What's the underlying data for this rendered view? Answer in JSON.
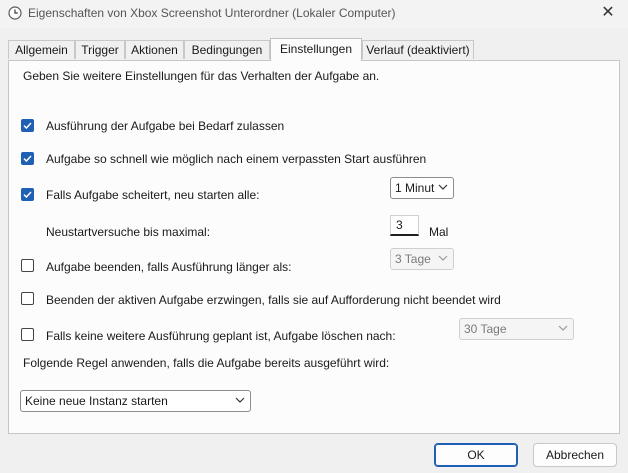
{
  "window": {
    "title": "Eigenschaften von Xbox Screenshot Unterordner (Lokaler Computer)",
    "title_icon": "clock-icon",
    "close_glyph": "✕"
  },
  "tabs": [
    {
      "label": "Allgemein",
      "active": false
    },
    {
      "label": "Trigger",
      "active": false
    },
    {
      "label": "Aktionen",
      "active": false
    },
    {
      "label": "Bedingungen",
      "active": false
    },
    {
      "label": "Einstellungen",
      "active": true
    },
    {
      "label": "Verlauf (deaktiviert)",
      "active": false
    }
  ],
  "settings": {
    "intro": "Geben Sie weitere Einstellungen für das Verhalten der Aufgabe an.",
    "allow_on_demand": {
      "label": "Ausführung der Aufgabe bei Bedarf zulassen",
      "checked": true
    },
    "run_asap": {
      "label": "Aufgabe so schnell wie möglich nach einem verpassten Start ausführen",
      "checked": true
    },
    "restart_on_fail": {
      "label": "Falls Aufgabe scheitert, neu starten alle:",
      "checked": true,
      "interval": "1 Minut"
    },
    "restart_attempts": {
      "label": "Neustartversuche bis maximal:",
      "value": "3",
      "unit": "Mal"
    },
    "stop_if_longer": {
      "label": "Aufgabe beenden, falls Ausführung länger als:",
      "checked": false,
      "duration": "3 Tage"
    },
    "force_stop": {
      "label": "Beenden der aktiven Aufgabe erzwingen, falls sie auf Aufforderung nicht beendet wird",
      "checked": false
    },
    "delete_if_not_scheduled": {
      "label": "Falls keine weitere Ausführung geplant ist, Aufgabe löschen nach:",
      "checked": false,
      "duration": "30 Tage"
    },
    "rule_label": "Folgende Regel anwenden, falls die Aufgabe bereits ausgeführt wird:",
    "rule_value": "Keine neue Instanz starten"
  },
  "buttons": {
    "ok": "OK",
    "cancel": "Abbrechen"
  },
  "colors": {
    "accent": "#1f5fb4",
    "background": "#f0f0f0",
    "panel": "#fcfcfc"
  }
}
